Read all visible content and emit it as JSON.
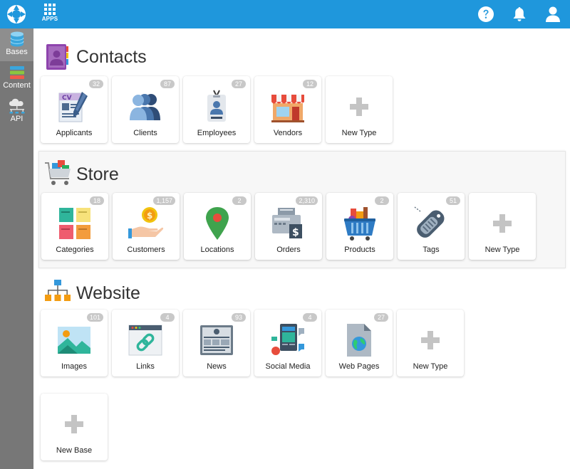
{
  "topbar": {
    "apps_label": "APPS",
    "logo_icon": "lifebuoy-logo-icon",
    "help_icon": "question-circle-icon",
    "notifications_icon": "bell-icon",
    "user_icon": "user-icon",
    "bar_color": "#1f97dc"
  },
  "sidebar": {
    "items": [
      {
        "label": "Bases",
        "icon": "database-icon"
      },
      {
        "label": "Content",
        "icon": "layers-icon"
      },
      {
        "label": "API",
        "icon": "cloud-api-icon"
      }
    ]
  },
  "sections": {
    "contacts": {
      "title": "Contacts",
      "cards": [
        {
          "label": "Applicants",
          "count": "32",
          "icon": "cv-document-icon"
        },
        {
          "label": "Clients",
          "count": "87",
          "icon": "people-group-icon"
        },
        {
          "label": "Employees",
          "count": "27",
          "icon": "id-badge-icon"
        },
        {
          "label": "Vendors",
          "count": "12",
          "icon": "storefront-icon"
        },
        {
          "label": "New Type",
          "icon": "plus-icon"
        }
      ]
    },
    "store": {
      "title": "Store",
      "cards": [
        {
          "label": "Categories",
          "count": "18",
          "icon": "sticky-notes-icon"
        },
        {
          "label": "Customers",
          "count": "1,157",
          "icon": "hand-coin-icon"
        },
        {
          "label": "Locations",
          "count": "2",
          "icon": "map-pin-icon"
        },
        {
          "label": "Orders",
          "count": "2,310",
          "icon": "cash-register-icon"
        },
        {
          "label": "Products",
          "count": "2",
          "icon": "shopping-basket-icon"
        },
        {
          "label": "Tags",
          "count": "51",
          "icon": "tag-icon"
        },
        {
          "label": "New Type",
          "icon": "plus-icon"
        }
      ]
    },
    "website": {
      "title": "Website",
      "cards": [
        {
          "label": "Images",
          "count": "101",
          "icon": "image-icon"
        },
        {
          "label": "Links",
          "count": "4",
          "icon": "chain-link-icon"
        },
        {
          "label": "News",
          "count": "93",
          "icon": "newspaper-icon"
        },
        {
          "label": "Social Media",
          "count": "4",
          "icon": "social-media-icon"
        },
        {
          "label": "Web Pages",
          "count": "27",
          "icon": "web-page-icon"
        },
        {
          "label": "New Type",
          "icon": "plus-icon"
        }
      ]
    }
  },
  "new_base": {
    "label": "New Base",
    "icon": "plus-icon"
  }
}
